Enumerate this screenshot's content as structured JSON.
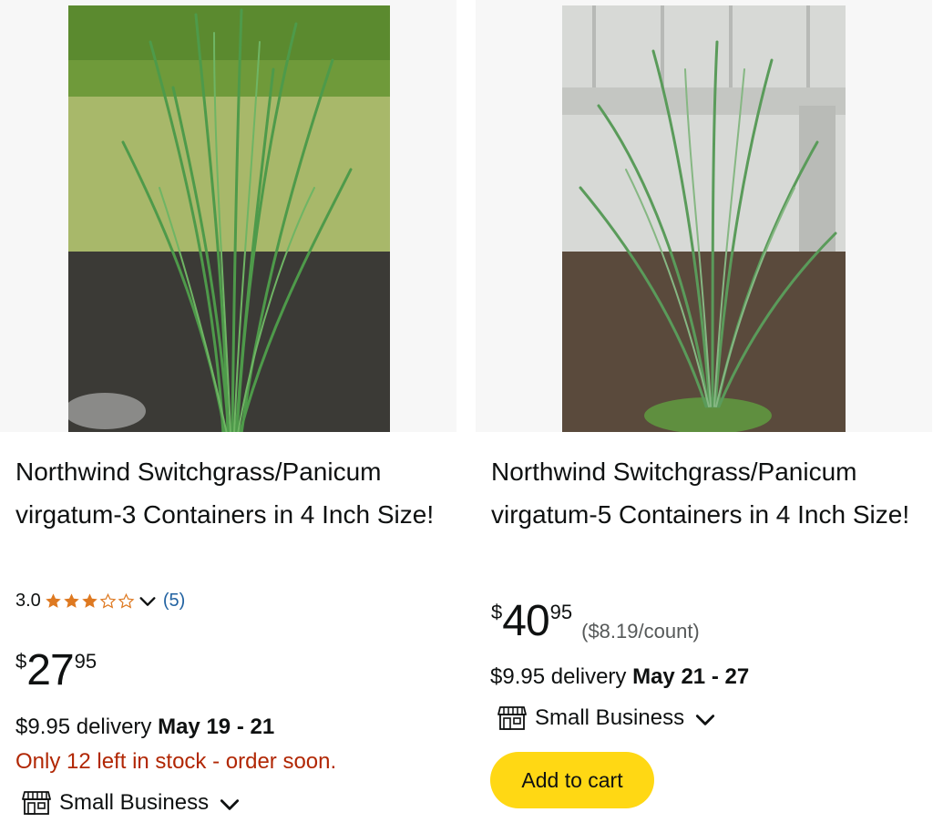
{
  "products": [
    {
      "title": "Northwind Switchgrass/Panicum virgatum-3 Containers in 4 Inch Size!",
      "rating_value": "3.0",
      "stars_filled": 3,
      "stars_total": 5,
      "review_count": "(5)",
      "price": {
        "symbol": "$",
        "whole": "27",
        "fraction": "95"
      },
      "delivery_prefix": "$9.95 delivery ",
      "delivery_dates": "May 19 - 21",
      "stock_note": "Only 12 left in stock - order soon.",
      "small_business_label": "Small Business",
      "image_icon": "ornamental-grass-photo"
    },
    {
      "title": "Northwind Switchgrass/Panicum virgatum-5 Containers in 4 Inch Size!",
      "price": {
        "symbol": "$",
        "whole": "40",
        "fraction": "95"
      },
      "unit_price": "($8.19/count)",
      "delivery_prefix": "$9.95 delivery ",
      "delivery_dates": "May 21 - 27",
      "small_business_label": "Small Business",
      "add_to_cart_label": "Add to cart",
      "image_icon": "ornamental-grass-photo"
    }
  ],
  "colors": {
    "star": "#de7921",
    "link": "#2162a1",
    "stock_warning": "#b12704",
    "add_to_cart": "#ffd814",
    "text": "#0f1111",
    "muted": "#565959"
  }
}
